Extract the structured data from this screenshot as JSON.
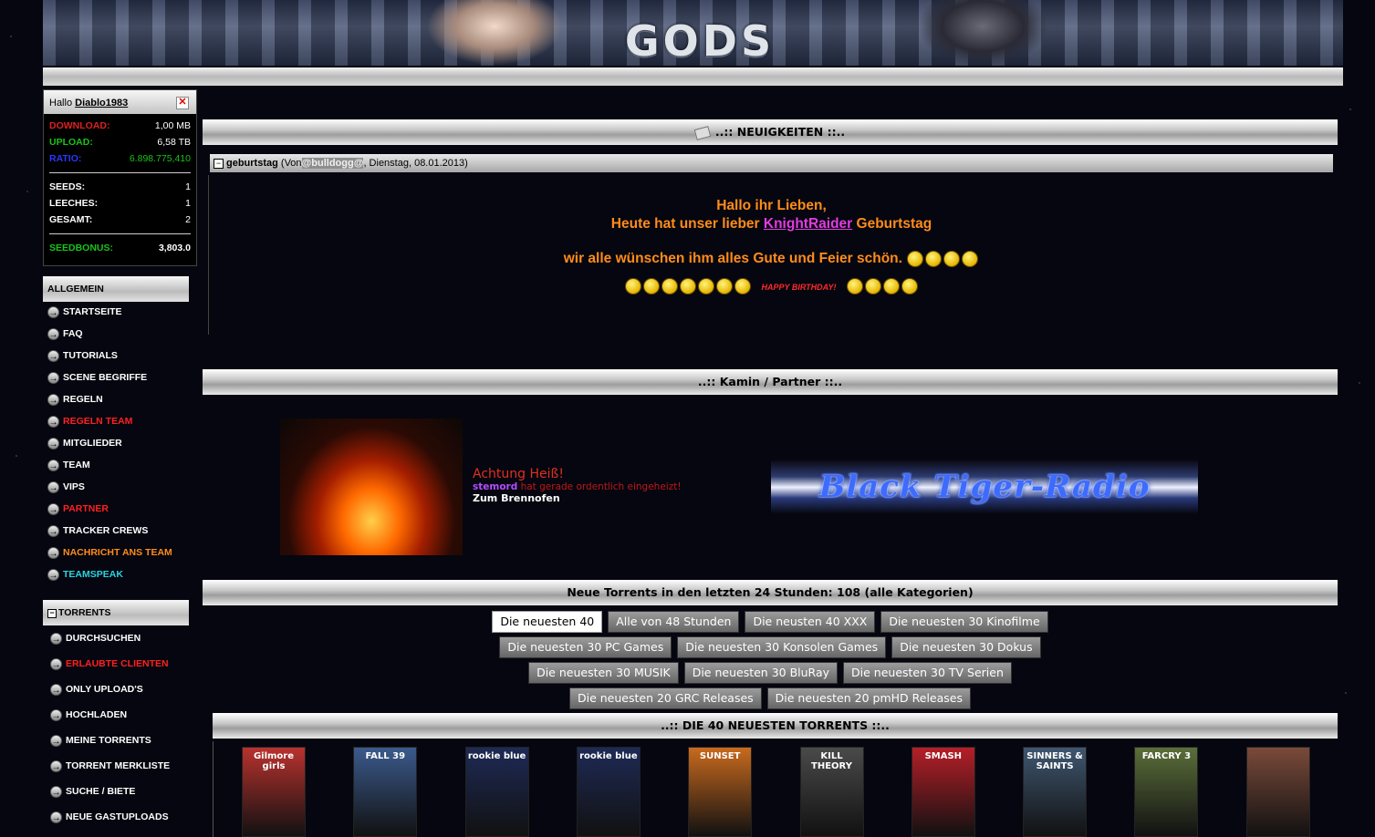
{
  "header": {
    "logo": "GODS",
    "nav_text": ""
  },
  "user": {
    "greeting": "Hallo",
    "username": "Diablo1983",
    "stats": [
      {
        "label": "Download:",
        "value": "1,00 MB",
        "color": "#e02020"
      },
      {
        "label": "Upload:",
        "value": "6,58 TB",
        "color": "#18c418"
      },
      {
        "label": "Ratio:",
        "value": "6.898.775,410",
        "color": "#2a36ff",
        "value_color": "#18c418"
      }
    ],
    "counts": [
      {
        "label": "Seeds:",
        "value": "1"
      },
      {
        "label": "Leeches:",
        "value": "1"
      },
      {
        "label": "Gesamt:",
        "value": "2"
      }
    ],
    "seedbonus": {
      "label": "Seedbonus:",
      "value": "3,803.0",
      "color": "#18c418"
    }
  },
  "sidebar": {
    "allgemein_title": "Allgemein",
    "allgemein": [
      {
        "label": "Startseite",
        "color": "#ffffff"
      },
      {
        "label": "FAQ",
        "color": "#ffffff"
      },
      {
        "label": "Tutorials",
        "color": "#ffffff"
      },
      {
        "label": "Scene Begriffe",
        "color": "#ffffff"
      },
      {
        "label": "Regeln",
        "color": "#ffffff"
      },
      {
        "label": "Regeln Team",
        "color": "#ff2020"
      },
      {
        "label": "Mitglieder",
        "color": "#ffffff"
      },
      {
        "label": "Team",
        "color": "#ffffff"
      },
      {
        "label": "VIPs",
        "color": "#ffffff"
      },
      {
        "label": "Partner",
        "color": "#ff2020"
      },
      {
        "label": "Tracker Crews",
        "color": "#ffffff"
      },
      {
        "label": "Nachricht ans Team",
        "color": "#ff8c1a"
      },
      {
        "label": "Teamspeak",
        "color": "#29d4e0"
      }
    ],
    "torrents_title": "Torrents",
    "torrents": [
      {
        "label": "Durchsuchen",
        "color": "#ffffff"
      },
      {
        "label": "Erlaubte Clienten",
        "color": "#ff2020"
      },
      {
        "label": "Only Upload's",
        "color": "#ffffff"
      },
      {
        "label": "Hochladen",
        "color": "#ffffff"
      },
      {
        "label": "Meine Torrents",
        "color": "#ffffff"
      },
      {
        "label": "Torrent Merkliste",
        "color": "#ffffff"
      },
      {
        "label": "Suche / Biete",
        "color": "#ffffff"
      },
      {
        "label": "Neue Gastuploads",
        "color": "#ffffff"
      }
    ]
  },
  "news": {
    "title": "..:: NEUIGKEITEN ::..",
    "item_title": "geburtstag",
    "item_meta_prefix": "(Von",
    "item_author": "@bulldogg@",
    "item_meta_suffix": ", Dienstag, 08.01.2013)",
    "line1": "Hallo ihr Lieben,",
    "line2_prefix": "Heute hat unser lieber",
    "line2_name": "KnightRaider",
    "line2_suffix": "Geburtstag",
    "line3": "wir alle wünschen ihm alles Gute und Feier schön.",
    "birthday_text": "HAPPY BIRTHDAY!"
  },
  "kamin": {
    "title": "..:: Kamin / Partner ::..",
    "heading": "Achtung Heiß!",
    "user": "stemord",
    "text": "hat gerade ordentlich eingeheizt!",
    "link": "Zum Brennofen",
    "radio": "Black Tiger-Radio"
  },
  "torrents": {
    "title": "Neue Torrents in den letzten 24 Stunden: 108 (alle Kategorien)",
    "tab_rows": [
      [
        "Die neuesten 40",
        "Alle von 48 Stunden",
        "Die neusten 40 XXX",
        "Die neuesten 30 Kinofilme"
      ],
      [
        "Die neuesten 30 PC Games",
        "Die neuesten 30 Konsolen Games",
        "Die neuesten 30 Dokus"
      ],
      [
        "Die neuesten 30 MUSIK",
        "Die neuesten 30 BluRay",
        "Die neuesten 30 TV Serien"
      ],
      [
        "Die neuesten 20 GRC Releases",
        "Die neuesten 20 pmHD Releases"
      ]
    ],
    "latest_title": "..:: DIE 40 NEUESTEN TORRENTS ::..",
    "posters": [
      {
        "label": "Gilmore girls",
        "color": "#b8322e"
      },
      {
        "label": "FALL 39",
        "color": "#3b5a8c"
      },
      {
        "label": "rookie blue",
        "color": "#1e2a55"
      },
      {
        "label": "rookie blue",
        "color": "#1e2a55"
      },
      {
        "label": "SUNSET",
        "color": "#c96a1e"
      },
      {
        "label": "KILL THEORY",
        "color": "#4a4a4a"
      },
      {
        "label": "SMASH",
        "color": "#b51f28"
      },
      {
        "label": "SINNERS & SAINTS",
        "color": "#3f5670"
      },
      {
        "label": "FARCRY 3",
        "color": "#5b6e3a"
      },
      {
        "label": "",
        "color": "#7a4a3a"
      }
    ]
  }
}
